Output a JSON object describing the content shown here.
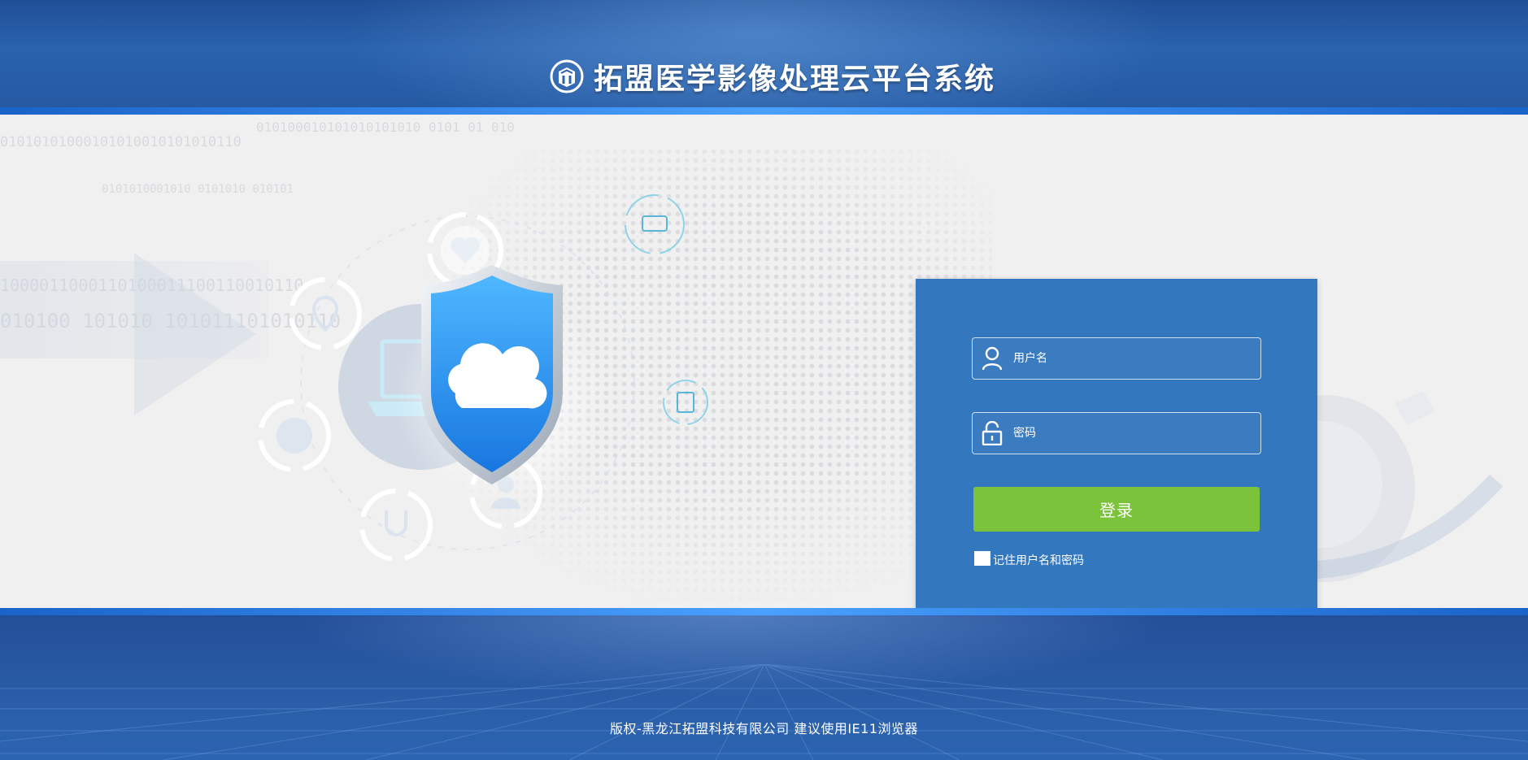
{
  "header": {
    "title": "拓盟医学影像处理云平台系统",
    "logo_icon": "box-logo-icon"
  },
  "background": {
    "binary_strings": [
      "010100010101010101010 0101 01 010",
      "01010101000101010010101010110",
      "0101010001010 0101010 010101",
      "1000011000110100011100110010110",
      "010100 101010 101011101010110"
    ]
  },
  "login": {
    "username_placeholder": "用户名",
    "password_placeholder": "密码",
    "submit_label": "登录",
    "remember_label": "记住用户名和密码",
    "colors": {
      "panel": "#3377bf",
      "button": "#7ac33b"
    }
  },
  "footer": {
    "copyright": "版权-黑龙江拓盟科技有限公司 建议使用IE11浏览器"
  }
}
